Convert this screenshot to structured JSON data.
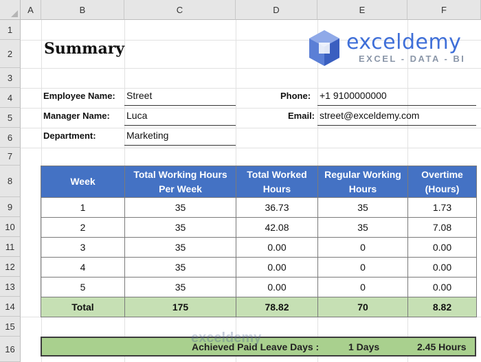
{
  "spreadsheet": {
    "columns": [
      "A",
      "B",
      "C",
      "D",
      "E",
      "F"
    ],
    "rows": [
      "1",
      "2",
      "3",
      "4",
      "5",
      "6",
      "7",
      "8",
      "9",
      "10",
      "11",
      "12",
      "13",
      "14",
      "15",
      "16"
    ]
  },
  "title": "Summary",
  "logo": {
    "word": "exceldemy",
    "tagline": "EXCEL - DATA - BI",
    "watermark": "exceldemy"
  },
  "info": {
    "employee_label": "Employee Name:",
    "employee_value": "Street",
    "manager_label": "Manager Name:",
    "manager_value": "Luca",
    "department_label": "Department:",
    "department_value": "Marketing",
    "phone_label": "Phone:",
    "phone_value": "+1 9100000000",
    "email_label": "Email:",
    "email_value": "street@exceldemy.com"
  },
  "table": {
    "headers": [
      "Week",
      "Total Working Hours Per Week",
      "Total Worked Hours",
      "Regular Working Hours",
      "Overtime (Hours)"
    ],
    "rows": [
      [
        "1",
        "35",
        "36.73",
        "35",
        "1.73"
      ],
      [
        "2",
        "35",
        "42.08",
        "35",
        "7.08"
      ],
      [
        "3",
        "35",
        "0.00",
        "0",
        "0.00"
      ],
      [
        "4",
        "35",
        "0.00",
        "0",
        "0.00"
      ],
      [
        "5",
        "35",
        "0.00",
        "0",
        "0.00"
      ]
    ],
    "total": [
      "Total",
      "175",
      "78.82",
      "70",
      "8.82"
    ]
  },
  "leave": {
    "label": "Achieved Paid Leave Days :",
    "days": "1 Days",
    "hours": "2.45 Hours"
  },
  "colors": {
    "header_blue": "#4472c4",
    "total_green": "#c6e0b4",
    "leave_green": "#a9d08e",
    "logo_blue": "#3f6fd8"
  }
}
